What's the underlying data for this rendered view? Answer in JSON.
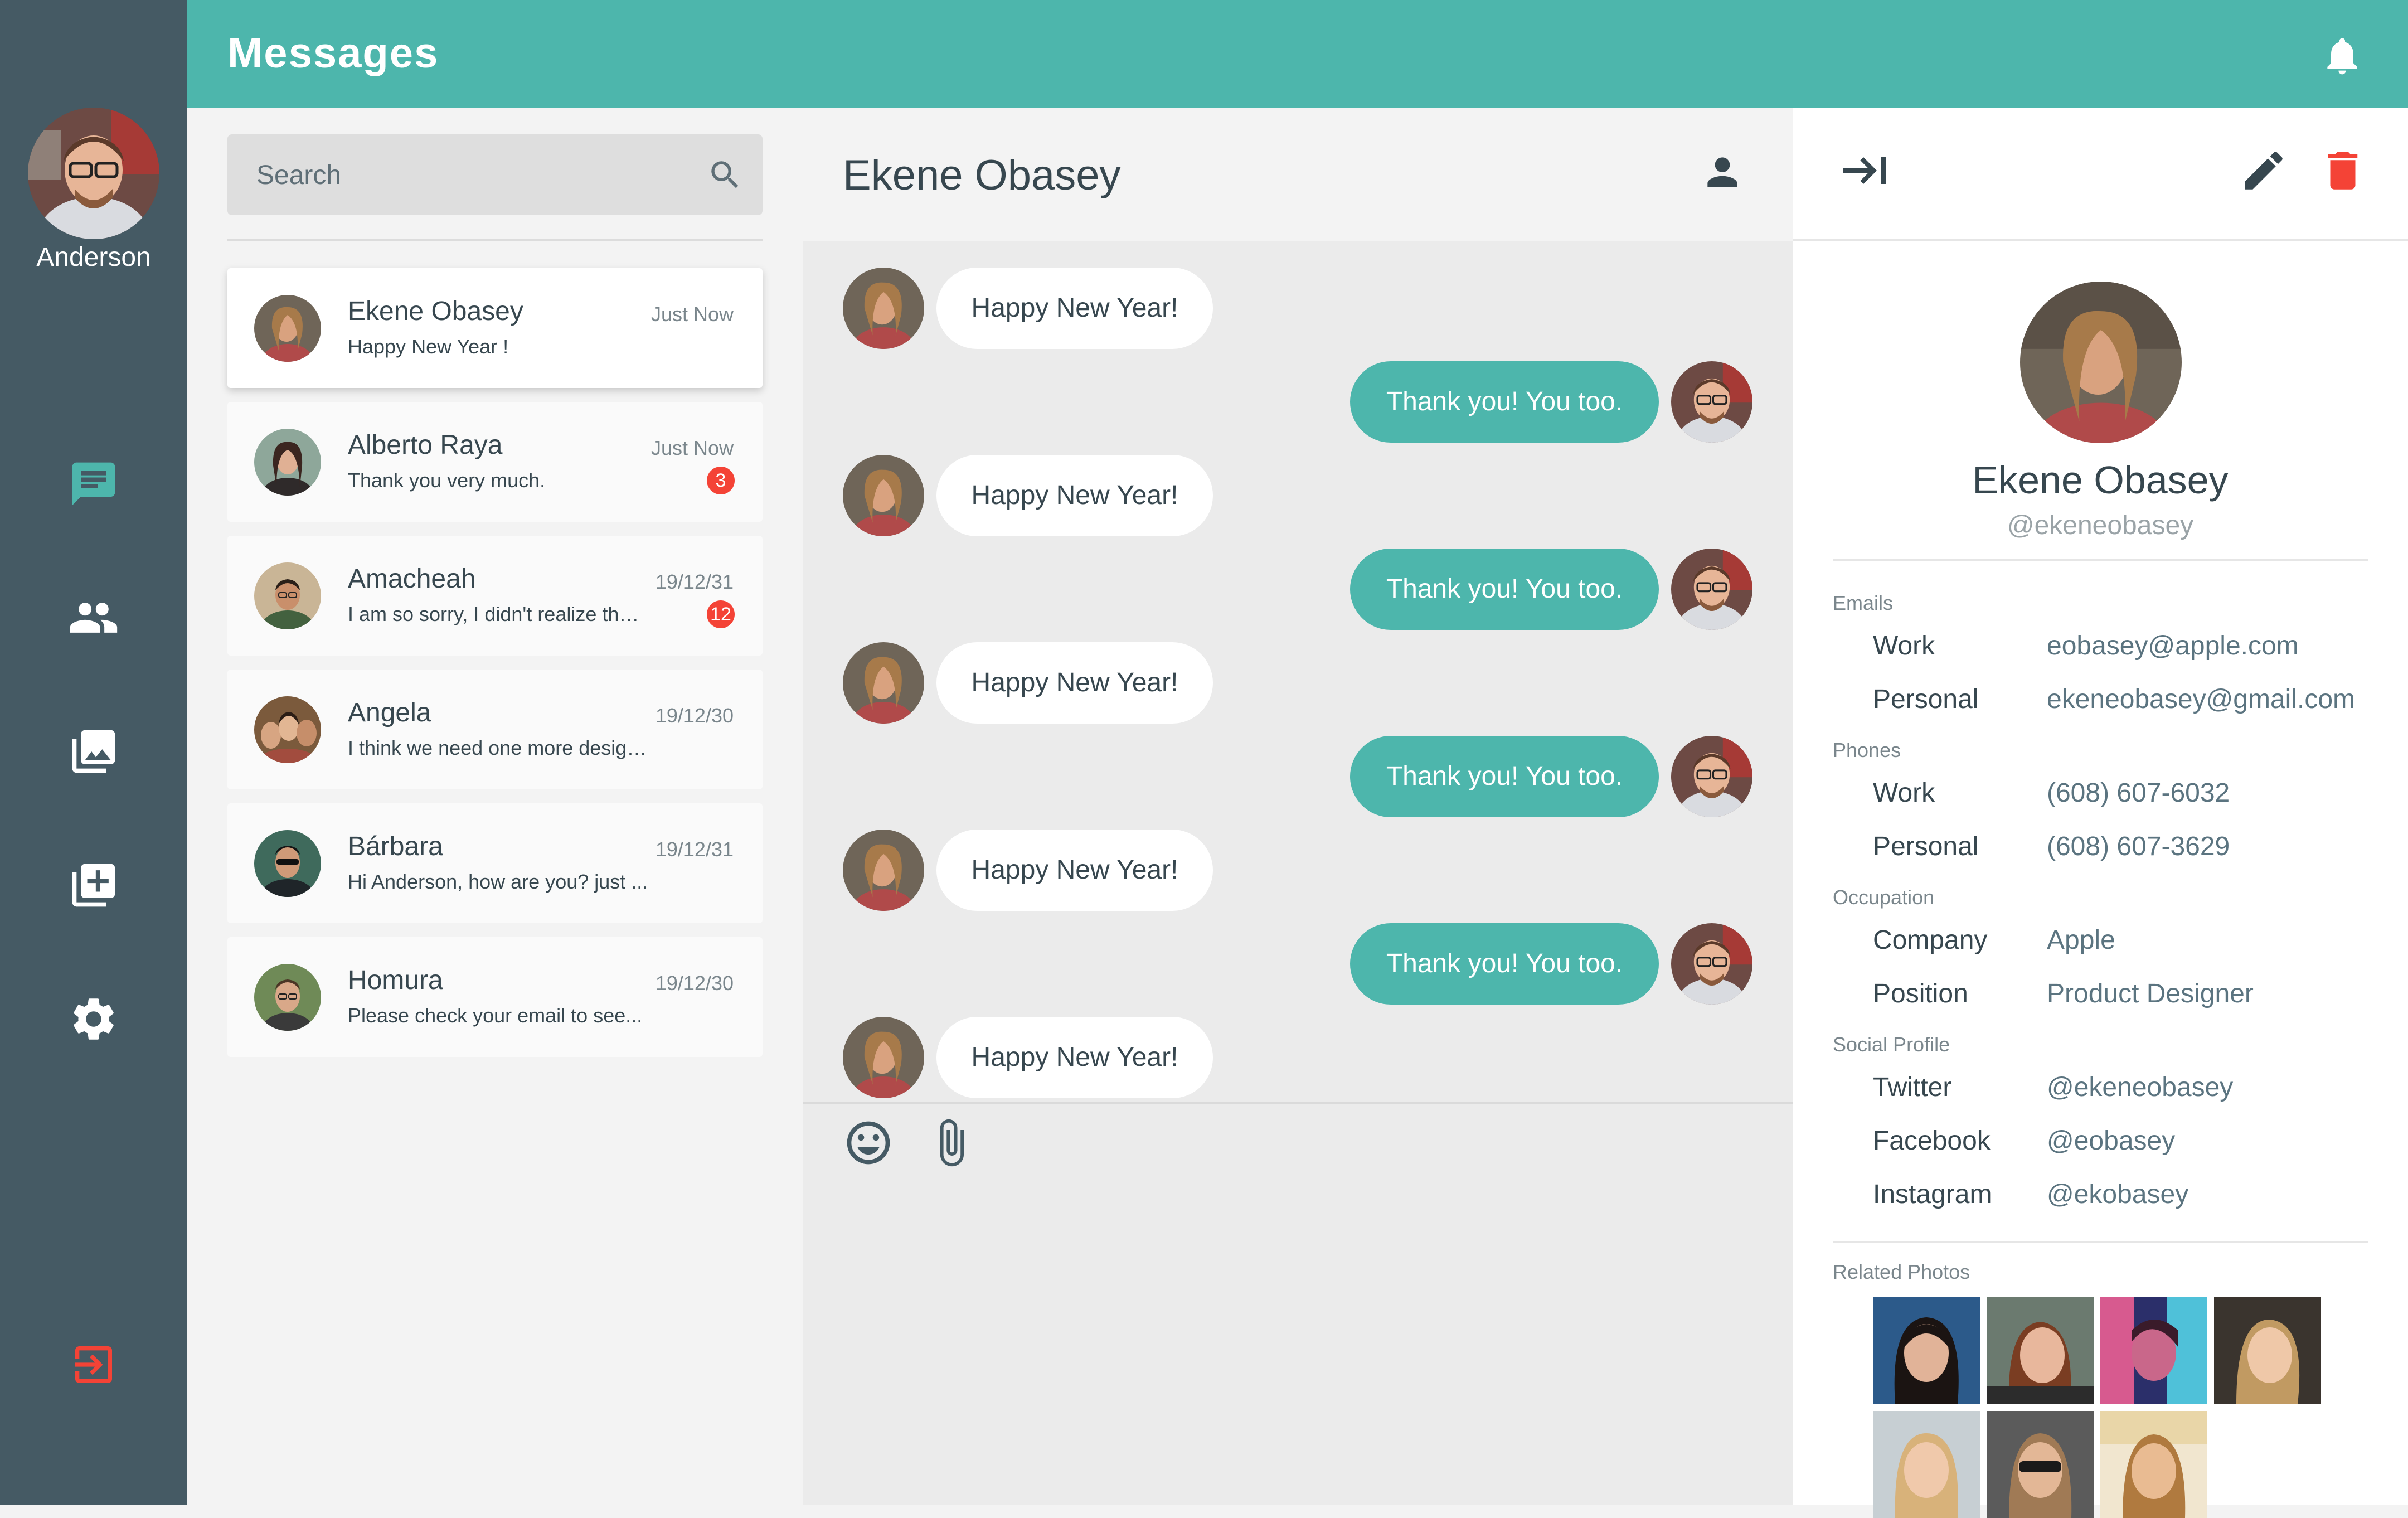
{
  "app": {
    "title": "Messages"
  },
  "user": {
    "name": "Anderson"
  },
  "colors": {
    "accent": "#4db6ac",
    "rail": "#455a64",
    "danger": "#f44336",
    "text": "#37474f"
  },
  "nav": [
    {
      "name": "messages",
      "icon": "chat-icon",
      "active": true
    },
    {
      "name": "contacts",
      "icon": "people-icon"
    },
    {
      "name": "photos",
      "icon": "photo-library-icon"
    },
    {
      "name": "add",
      "icon": "library-add-icon"
    },
    {
      "name": "settings",
      "icon": "gear-icon"
    },
    {
      "name": "logout",
      "icon": "logout-icon"
    }
  ],
  "search": {
    "placeholder": "Search"
  },
  "conversations": [
    {
      "name": "Ekene Obasey",
      "time": "Just Now",
      "snippet": "Happy New Year !",
      "badge": ""
    },
    {
      "name": "Alberto Raya",
      "time": "Just Now",
      "snippet": "Thank you very much.",
      "badge": "3"
    },
    {
      "name": "Amacheah",
      "time": "19/12/31",
      "snippet": "I am so sorry, I didn't realize that...",
      "badge": "12"
    },
    {
      "name": "Angela",
      "time": "19/12/30",
      "snippet": "I think we need one more design...",
      "badge": ""
    },
    {
      "name": "Bárbara",
      "time": "19/12/31",
      "snippet": "Hi Anderson, how are you? just ...",
      "badge": ""
    },
    {
      "name": "Homura",
      "time": "19/12/30",
      "snippet": "Please check your email to see...",
      "badge": ""
    }
  ],
  "chat": {
    "contact_name": "Ekene Obasey",
    "messages": [
      {
        "from": "them",
        "text": "Happy New Year!"
      },
      {
        "from": "me",
        "text": "Thank you! You too."
      },
      {
        "from": "them",
        "text": "Happy New Year!"
      },
      {
        "from": "me",
        "text": "Thank you! You too."
      },
      {
        "from": "them",
        "text": "Happy New Year!"
      },
      {
        "from": "me",
        "text": "Thank you! You too."
      },
      {
        "from": "them",
        "text": "Happy New Year!"
      },
      {
        "from": "me",
        "text": "Thank you! You too."
      },
      {
        "from": "them",
        "text": "Happy New Year!"
      }
    ]
  },
  "profile": {
    "name": "Ekene Obasey",
    "handle": "@ekeneobasey",
    "emails": {
      "title": "Emails",
      "rows": [
        {
          "label": "Work",
          "value": "eobasey@apple.com"
        },
        {
          "label": "Personal",
          "value": "ekeneobasey@gmail.com"
        }
      ]
    },
    "phones": {
      "title": "Phones",
      "rows": [
        {
          "label": "Work",
          "value": "(608) 607-6032"
        },
        {
          "label": "Personal",
          "value": "(608) 607-3629"
        }
      ]
    },
    "occupation": {
      "title": "Occupation",
      "rows": [
        {
          "label": "Company",
          "value": "Apple"
        },
        {
          "label": "Position",
          "value": "Product Designer"
        }
      ]
    },
    "social": {
      "title": "Social Profile",
      "rows": [
        {
          "label": "Twitter",
          "value": "@ekeneobasey"
        },
        {
          "label": "Facebook",
          "value": "@eobasey"
        },
        {
          "label": "Instagram",
          "value": "@ekobasey"
        }
      ]
    },
    "related_photos": {
      "title": "Related Photos"
    }
  }
}
